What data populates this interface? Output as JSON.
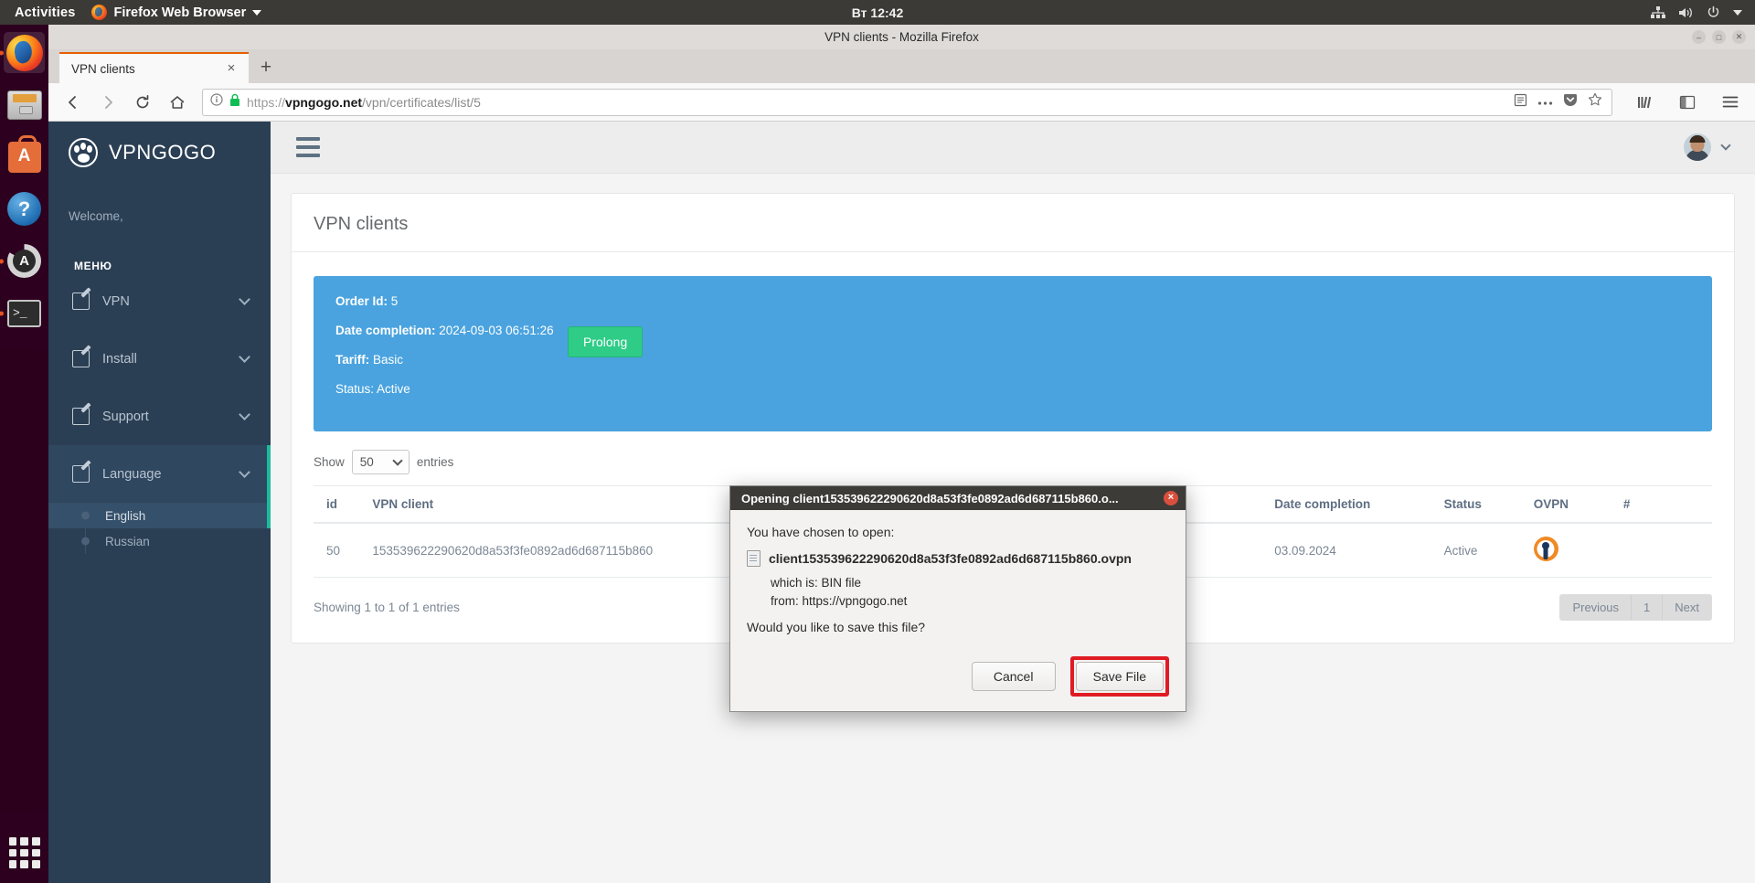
{
  "desktop": {
    "activities": "Activities",
    "app_menu": "Firefox Web Browser",
    "clock": "Вт 12:42",
    "tray": [
      "network-icon",
      "volume-icon",
      "power-icon",
      "chevron-down-icon"
    ],
    "dock": [
      {
        "name": "firefox",
        "label": "Firefox Web Browser",
        "running": true,
        "active": true
      },
      {
        "name": "files",
        "label": "Files",
        "running": false,
        "active": false
      },
      {
        "name": "software",
        "label": "Ubuntu Software",
        "running": false,
        "active": false
      },
      {
        "name": "help",
        "label": "Help",
        "running": false,
        "active": false
      },
      {
        "name": "updater",
        "label": "Software Updater",
        "running": true,
        "active": false
      },
      {
        "name": "terminal",
        "label": "Terminal",
        "running": true,
        "active": false
      }
    ]
  },
  "browser": {
    "window_title": "VPN clients - Mozilla Firefox",
    "tab": {
      "title": "VPN clients",
      "close_label": "×"
    },
    "new_tab_label": "+",
    "url": {
      "scheme": "https://",
      "host": "vpngogo.net",
      "path": "/vpn/certificates/list/5"
    },
    "nav": {
      "back": "←",
      "forward": "→",
      "reload": "↻",
      "home": "⌂"
    }
  },
  "sidebar": {
    "brand": "VPNGOGO",
    "welcome": "Welcome,",
    "menu_heading": "МЕНЮ",
    "items": [
      {
        "label": "VPN",
        "expanded": false
      },
      {
        "label": "Install",
        "expanded": false
      },
      {
        "label": "Support",
        "expanded": false
      },
      {
        "label": "Language",
        "expanded": true
      }
    ],
    "language_sub": [
      {
        "label": "English",
        "active": true
      },
      {
        "label": "Russian",
        "active": false
      }
    ]
  },
  "page": {
    "title": "VPN clients",
    "info_panel": {
      "order_id_label": "Order Id:",
      "order_id_value": "5",
      "date_completion_label": "Date completion:",
      "date_completion_value": "2024-09-03 06:51:26",
      "prolong_button": "Prolong",
      "tariff_label": "Tariff:",
      "tariff_value": "Basic",
      "status_label": "Status:",
      "status_value": "Active"
    },
    "table_controls": {
      "show_label": "Show",
      "entries_value": "50",
      "entries_label": "entries"
    },
    "table": {
      "headers": [
        "id",
        "VPN client",
        "",
        "Date completion",
        "Status",
        "OVPN",
        "#"
      ],
      "rows": [
        {
          "id": "50",
          "client": "153539622290620d8a53f3fe0892ad6d687115b860",
          "blank": "",
          "date": "03.09.2024",
          "status": "Active",
          "ovpn": "openvpn-icon",
          "hash": ""
        }
      ]
    },
    "footer": {
      "showing": "Showing 1 to 1 of 1 entries",
      "pagination": [
        "Previous",
        "1",
        "Next"
      ]
    }
  },
  "dialog": {
    "title": "Opening client153539622290620d8a53f3fe0892ad6d687115b860.o...",
    "close_label": "×",
    "intro": "You have chosen to open:",
    "filename": "client153539622290620d8a53f3fe0892ad6d687115b860.ovpn",
    "which_is_label": "which is:",
    "which_is_value": "BIN file",
    "from_label": "from:",
    "from_value": "https://vpngogo.net",
    "question": "Would you like to save this file?",
    "cancel_button": "Cancel",
    "save_button": "Save File"
  },
  "colors": {
    "sidebar_bg": "#2b3f54",
    "accent_teal": "#1abc9c",
    "info_blue": "#4aa3df",
    "prolong_green": "#2ecc87",
    "ovpn_orange": "#f08a24",
    "highlight_red": "#e01b24",
    "firefox_orange": "#e66000"
  }
}
